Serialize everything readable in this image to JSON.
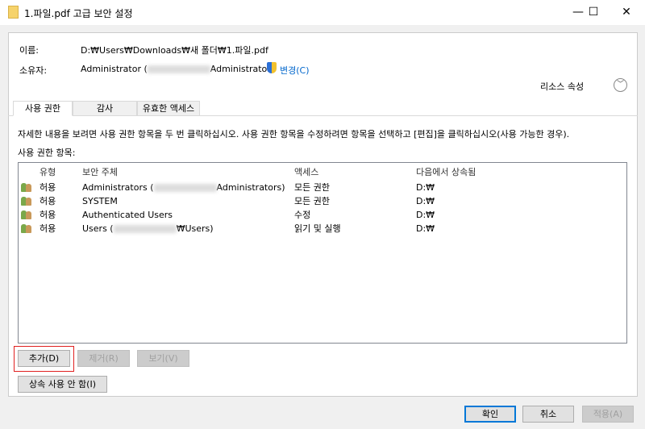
{
  "window": {
    "title": "1.파일.pdf 고급 보안 설정",
    "minimize": "—",
    "maximize": "☐",
    "close": "✕"
  },
  "info": {
    "name_label": "이름:",
    "name_value": "D:₩Users₩Downloads₩새 폴더₩1.파일.pdf",
    "owner_label": "소유자:",
    "owner_prefix": "Administrator (",
    "owner_suffix": "Administrator)",
    "change_link": "변경(C)",
    "resource_attr": "리소스 속성"
  },
  "tabs": [
    {
      "label": "사용 권한"
    },
    {
      "label": "감사"
    },
    {
      "label": "유효한 액세스"
    }
  ],
  "instructions": "자세한 내용을 보려면 사용 권한 항목을 두 번 클릭하십시오. 사용 권한 항목을 수정하려면 항목을 선택하고 [편집]을 클릭하십시오(사용 가능한 경우).",
  "entries_label": "사용 권한 항목:",
  "columns": [
    "유형",
    "보안 주체",
    "액세스",
    "다음에서 상속됨"
  ],
  "rows": [
    {
      "type": "허용",
      "principal_prefix": "Administrators (",
      "principal_suffix": "Administrators)",
      "access": "모든 권한",
      "inherited": "D:₩"
    },
    {
      "type": "허용",
      "principal_prefix": "SYSTEM",
      "principal_suffix": "",
      "access": "모든 권한",
      "inherited": "D:₩"
    },
    {
      "type": "허용",
      "principal_prefix": "Authenticated Users",
      "principal_suffix": "",
      "access": "수정",
      "inherited": "D:₩"
    },
    {
      "type": "허용",
      "principal_prefix": "Users (",
      "principal_suffix": "₩Users)",
      "access": "읽기 및 실행",
      "inherited": "D:₩"
    }
  ],
  "buttons": {
    "add": "추가(D)",
    "remove": "제거(R)",
    "view": "보기(V)",
    "disable_inherit": "상속 사용 안 함(I)",
    "ok": "확인",
    "cancel": "취소",
    "apply": "적용(A)"
  }
}
